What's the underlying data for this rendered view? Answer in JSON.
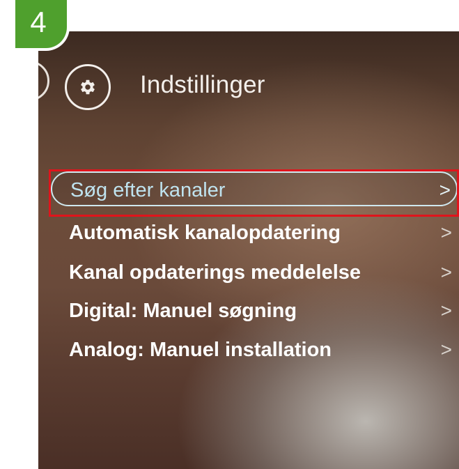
{
  "step_badge": {
    "number": "4"
  },
  "header": {
    "title": "Indstillinger",
    "icon": "gear-icon"
  },
  "menu": {
    "items": [
      {
        "label": "Søg efter kanaler",
        "chevron": ">",
        "selected": true
      },
      {
        "label": "Automatisk kanalopdatering",
        "chevron": ">"
      },
      {
        "label": "Kanal opdaterings meddelelse",
        "chevron": ">"
      },
      {
        "label": "Digital: Manuel søgning",
        "chevron": ">"
      },
      {
        "label": "Analog: Manuel installation",
        "chevron": ">"
      }
    ]
  },
  "colors": {
    "step_badge": "#4fa02d",
    "highlight": "#e0141c",
    "selected_text": "#bfe3ef",
    "menu_text": "#ffffff"
  }
}
